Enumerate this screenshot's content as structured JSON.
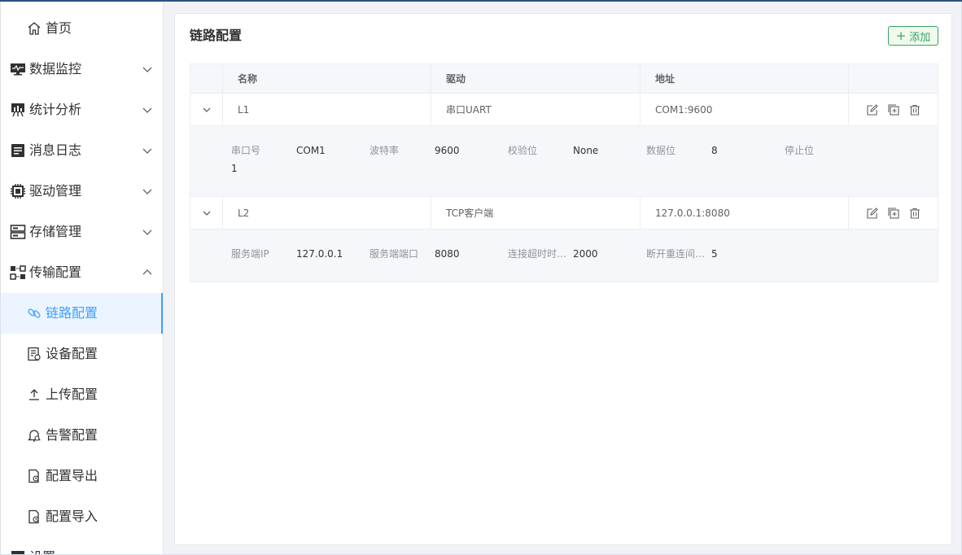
{
  "sidebar": {
    "home": "首页",
    "groups": [
      {
        "label": "数据监控",
        "icon": "monitor-icon",
        "expanded": false
      },
      {
        "label": "统计分析",
        "icon": "chart-board-icon",
        "expanded": false
      },
      {
        "label": "消息日志",
        "icon": "log-icon",
        "expanded": false
      },
      {
        "label": "驱动管理",
        "icon": "chip-icon",
        "expanded": false
      },
      {
        "label": "存储管理",
        "icon": "server-icon",
        "expanded": false
      },
      {
        "label": "传输配置",
        "icon": "transfer-icon",
        "expanded": true
      }
    ],
    "sub_items": [
      {
        "label": "链路配置",
        "icon": "link-icon",
        "active": true
      },
      {
        "label": "设备配置",
        "icon": "device-doc-icon",
        "active": false
      },
      {
        "label": "上传配置",
        "icon": "upload-icon",
        "active": false
      },
      {
        "label": "告警配置",
        "icon": "alarm-bell-icon",
        "active": false
      },
      {
        "label": "配置导出",
        "icon": "export-file-icon",
        "active": false
      },
      {
        "label": "配置导入",
        "icon": "import-file-icon",
        "active": false
      }
    ],
    "partial_next": "设置"
  },
  "page": {
    "title": "链路配置",
    "add_label": "添加"
  },
  "table": {
    "headers": [
      "名称",
      "驱动",
      "地址"
    ],
    "rows": [
      {
        "name": "L1",
        "driver": "串口UART",
        "address": "COM1:9600",
        "details": [
          {
            "key": "串口号",
            "value": "COM1"
          },
          {
            "key": "波特率",
            "value": "9600"
          },
          {
            "key": "校验位",
            "value": "None"
          },
          {
            "key": "数据位",
            "value": "8"
          },
          {
            "key": "停止位",
            "value": "1"
          }
        ]
      },
      {
        "name": "L2",
        "driver": "TCP客户端",
        "address": "127.0.0.1:8080",
        "details": [
          {
            "key": "服务端IP",
            "value": "127.0.0.1"
          },
          {
            "key": "服务端端口",
            "value": "8080"
          },
          {
            "key": "连接超时时…",
            "value": "2000"
          },
          {
            "key": "断开重连间…",
            "value": "5"
          }
        ]
      }
    ]
  },
  "colors": {
    "accent": "#409eff",
    "add_button": "#3aa26a",
    "topline": "#2f4f7f"
  }
}
